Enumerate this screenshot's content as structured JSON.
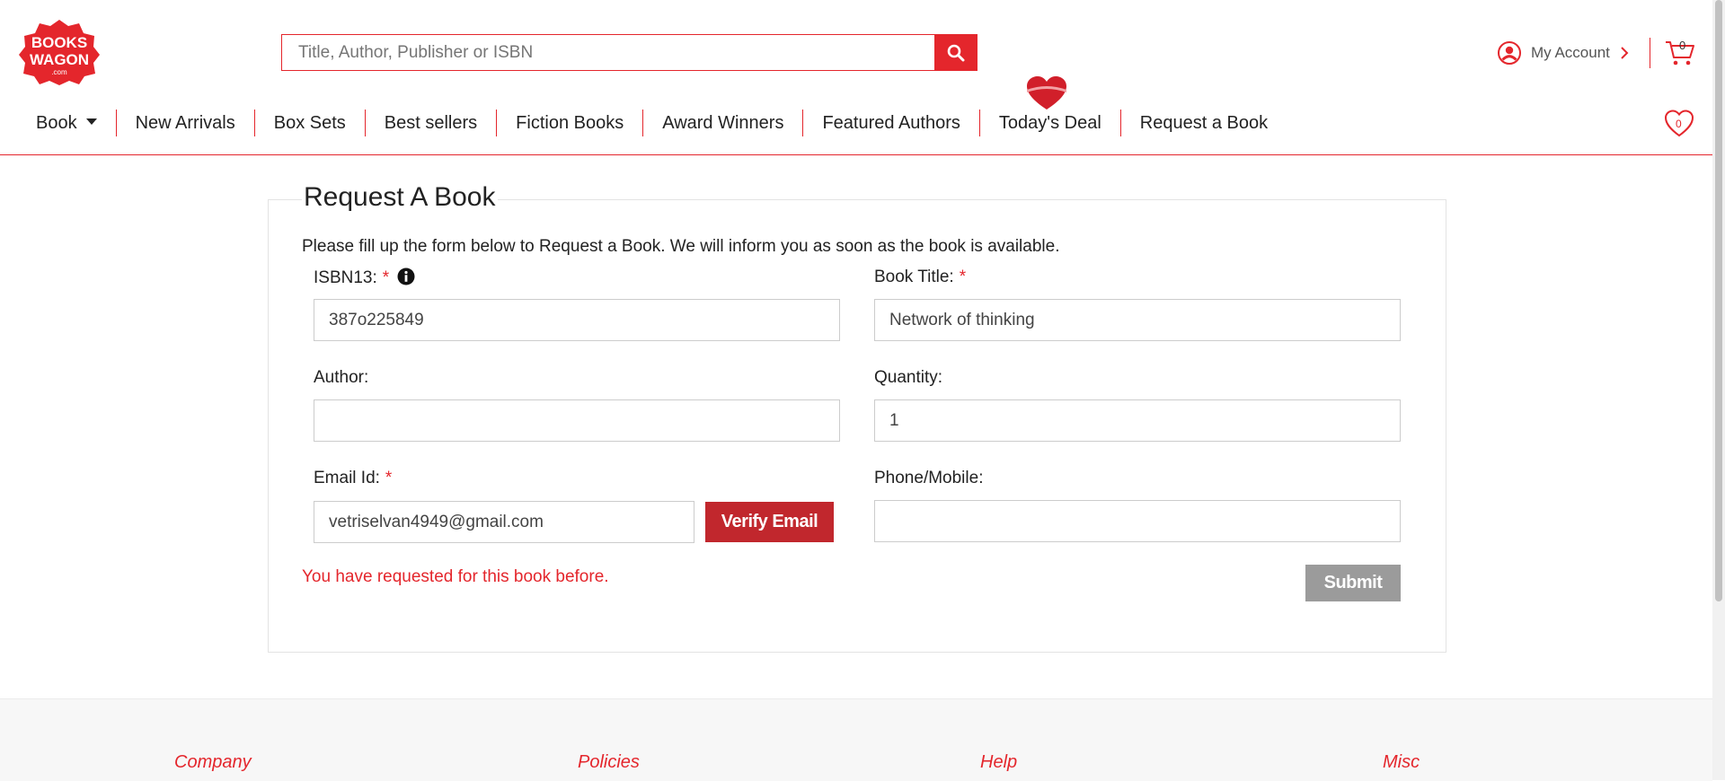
{
  "brand": {
    "logo_text_line1": "BOOKS",
    "logo_text_line2": "WAGON",
    "logo_text_line3": ".com",
    "color": "#e4262c"
  },
  "search": {
    "placeholder": "Title, Author, Publisher or ISBN",
    "icon": "search-icon"
  },
  "account": {
    "label": "My Account",
    "icon": "user-circle-icon"
  },
  "cart": {
    "count": "0",
    "icon": "cart-icon"
  },
  "wishlist": {
    "count": "0",
    "icon": "heart-icon"
  },
  "nav": {
    "items": [
      {
        "label": "Book"
      },
      {
        "label": "New Arrivals"
      },
      {
        "label": "Box Sets"
      },
      {
        "label": "Best sellers"
      },
      {
        "label": "Fiction Books"
      },
      {
        "label": "Award Winners"
      },
      {
        "label": "Featured Authors"
      },
      {
        "label": "Today's Deal"
      },
      {
        "label": "Request a Book"
      }
    ]
  },
  "form": {
    "legend": "Request A Book",
    "intro": "Please fill up the form below to Request a Book. We will inform you as soon as the book is available.",
    "required_mark": "*",
    "isbn": {
      "label": "ISBN13:",
      "value": "387o225849"
    },
    "title": {
      "label": "Book Title:",
      "value": "Network of thinking"
    },
    "author": {
      "label": "Author:",
      "value": ""
    },
    "quantity": {
      "label": "Quantity:",
      "value": "1"
    },
    "email": {
      "label": "Email Id:",
      "value": "vetriselvan4949@gmail.com"
    },
    "phone": {
      "label": "Phone/Mobile:",
      "value": ""
    },
    "verify_label": "Verify Email",
    "error": "You have requested for this book before.",
    "submit_label": "Submit"
  },
  "footer": {
    "headings": [
      "Company",
      "Policies",
      "Help",
      "Misc"
    ]
  }
}
